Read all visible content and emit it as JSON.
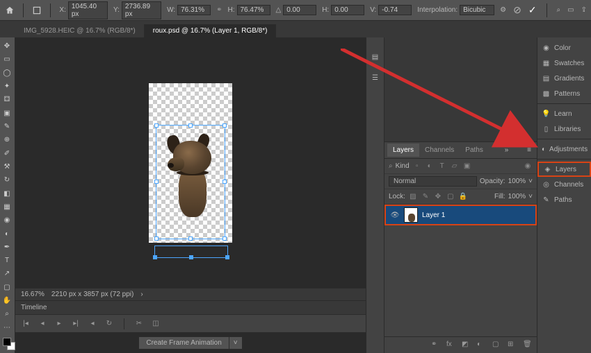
{
  "opbar": {
    "x_label": "X:",
    "x_val": "1045.40 px",
    "y_label": "Y:",
    "y_val": "2736.89 px",
    "w_label": "W:",
    "w_val": "76.31%",
    "h_label": "H:",
    "h_val": "76.47%",
    "angle_label": "△",
    "angle_val": "0.00",
    "h2_label": "H:",
    "h2_val": "0.00",
    "v_label": "V:",
    "v_val": "-0.74",
    "interp_label": "Interpolation:",
    "interp_val": "Bicubic"
  },
  "tabs": [
    {
      "label": "IMG_5928.HEIC @ 16.7% (RGB/8*)",
      "active": false
    },
    {
      "label": "roux.psd @ 16.7% (Layer 1, RGB/8*)",
      "active": true
    }
  ],
  "status": {
    "zoom": "16.67%",
    "dims": "2210 px x 3857 px (72 ppi)"
  },
  "timeline": {
    "label": "Timeline"
  },
  "frame": {
    "btn": "Create Frame Animation"
  },
  "layers_panel": {
    "tabs": [
      "Layers",
      "Channels",
      "Paths"
    ],
    "kind_label": "Kind",
    "blend": "Normal",
    "opacity_label": "Opacity:",
    "opacity_val": "100%",
    "lock_label": "Lock:",
    "fill_label": "Fill:",
    "fill_val": "100%",
    "layer1": "Layer 1"
  },
  "rightdock": [
    "Color",
    "Swatches",
    "Gradients",
    "Patterns",
    "Learn",
    "Libraries",
    "Adjustments",
    "Layers",
    "Channels",
    "Paths"
  ]
}
